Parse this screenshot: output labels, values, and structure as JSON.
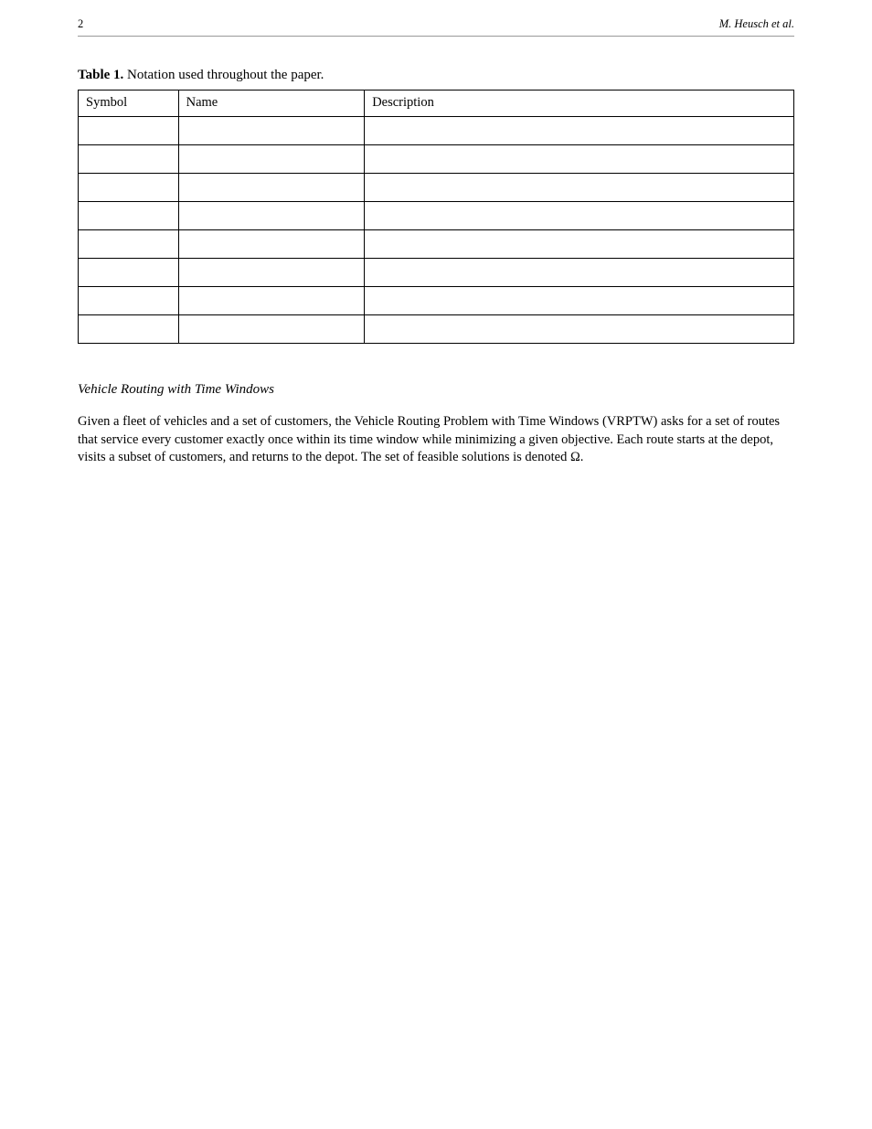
{
  "header": {
    "left": "2",
    "right": "M. Heusch et al."
  },
  "table_caption_prefix": "Table 1.",
  "table_caption": "Notation used throughout the paper.",
  "table": {
    "headers": [
      "Symbol",
      "Name",
      "Description"
    ],
    "rows": [
      [
        "",
        "",
        ""
      ],
      [
        "",
        "",
        ""
      ],
      [
        "",
        "",
        ""
      ],
      [
        "",
        "",
        ""
      ],
      [
        "",
        "",
        ""
      ],
      [
        "",
        "",
        ""
      ],
      [
        "",
        "",
        ""
      ],
      [
        "",
        "",
        ""
      ]
    ]
  },
  "section_heading": "Vehicle Routing with Time Windows",
  "body_paragraph": "Given a fleet of vehicles and a set of customers, the Vehicle Routing Problem with Time Windows (VRPTW) asks for a set of routes that service every customer exactly once within its time window while minimizing a given objective. Each route starts at the depot, visits a subset of customers, and returns to the depot. The set of feasible solutions is denoted Ω."
}
